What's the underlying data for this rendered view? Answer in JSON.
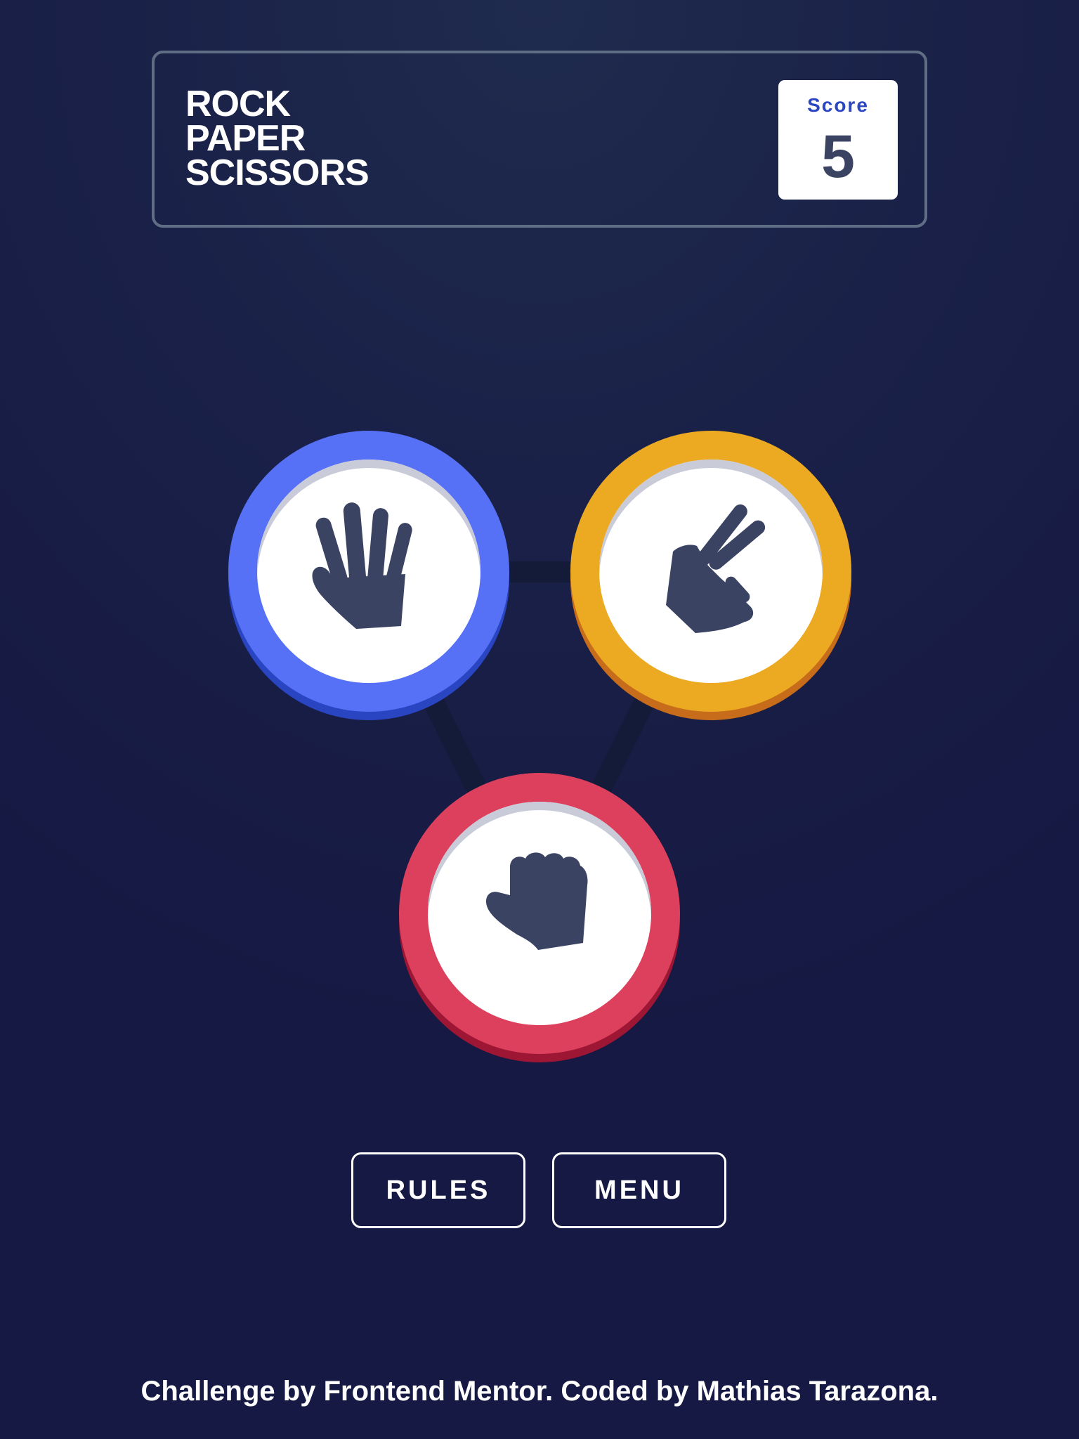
{
  "header": {
    "title_lines": [
      "Rock",
      "Paper",
      "Scissors"
    ],
    "score_label": "Score",
    "score_value": "5"
  },
  "choices": [
    {
      "name": "paper",
      "icon": "paper-hand-icon",
      "color": "#5671f5",
      "shadow": "#2a45c2"
    },
    {
      "name": "scissors",
      "icon": "scissors-hand-icon",
      "color": "#eca922",
      "shadow": "#c76c1b"
    },
    {
      "name": "rock",
      "icon": "rock-fist-icon",
      "color": "#dd405d",
      "shadow": "#9d1634"
    }
  ],
  "buttons": {
    "rules_label": "RULES",
    "menu_label": "MENU"
  },
  "footer": {
    "text": "Challenge by Frontend Mentor. Coded by Mathias Tarazona."
  },
  "colors": {
    "background": "#1a2148",
    "header_border": "#606e85",
    "score_label": "#2a46c0",
    "score_value": "#3b4363",
    "icon": "#3b4363"
  }
}
